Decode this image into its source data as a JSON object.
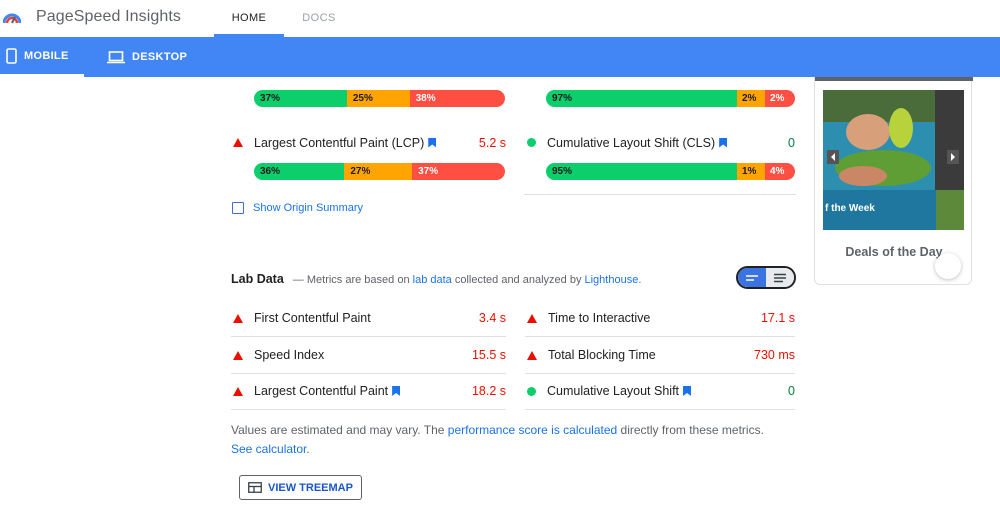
{
  "header": {
    "app_title": "PageSpeed Insights",
    "nav": [
      {
        "label": "HOME",
        "active": true
      },
      {
        "label": "DOCS",
        "active": false
      }
    ]
  },
  "modes": [
    {
      "label": "MOBILE",
      "icon": "phone-icon",
      "active": true
    },
    {
      "label": "DESKTOP",
      "icon": "laptop-icon",
      "active": false
    }
  ],
  "field": {
    "left_top_bar": {
      "good": "37%",
      "avg": "25%",
      "poor": "38%"
    },
    "right_top_bar": {
      "good": "97%",
      "avg": "2%",
      "poor": "2%"
    },
    "lcp": {
      "label": "Largest Contentful Paint (LCP)",
      "value": "5.2 s",
      "status": "poor"
    },
    "lcp_bar": {
      "good": "36%",
      "avg": "27%",
      "poor": "37%"
    },
    "cls": {
      "label": "Cumulative Layout Shift (CLS)",
      "value": "0",
      "status": "good"
    },
    "cls_bar": {
      "good": "95%",
      "avg": "1%",
      "poor": "4%"
    },
    "origin_summary": "Show Origin Summary"
  },
  "lab": {
    "title": "Lab Data",
    "desc_prefix": "— Metrics are based on ",
    "desc_link1": "lab data",
    "desc_mid": " collected and analyzed by ",
    "desc_link2": "Lighthouse",
    "desc_suffix": ".",
    "metrics_left": [
      {
        "label": "First Contentful Paint",
        "value": "3.4 s",
        "status": "poor",
        "bookmark": false
      },
      {
        "label": "Speed Index",
        "value": "15.5 s",
        "status": "poor",
        "bookmark": false
      },
      {
        "label": "Largest Contentful Paint",
        "value": "18.2 s",
        "status": "poor",
        "bookmark": true
      }
    ],
    "metrics_right": [
      {
        "label": "Time to Interactive",
        "value": "17.1 s",
        "status": "poor",
        "bookmark": false
      },
      {
        "label": "Total Blocking Time",
        "value": "730 ms",
        "status": "poor",
        "bookmark": false
      },
      {
        "label": "Cumulative Layout Shift",
        "value": "0",
        "status": "good",
        "bookmark": true
      }
    ]
  },
  "footnote": {
    "prefix": "Values are estimated and may vary. The ",
    "link1": "performance score is calculated",
    "mid": " directly from these metrics. ",
    "link2": "See calculator",
    "suffix": "."
  },
  "treemap_button": "VIEW TREEMAP",
  "ad": {
    "caption": "Deals of the Day",
    "image_text": "f the Week"
  },
  "colors": {
    "accent": "#4285f4",
    "good": "#0cce6b",
    "average": "#ffa400",
    "poor": "#ff4e42"
  }
}
